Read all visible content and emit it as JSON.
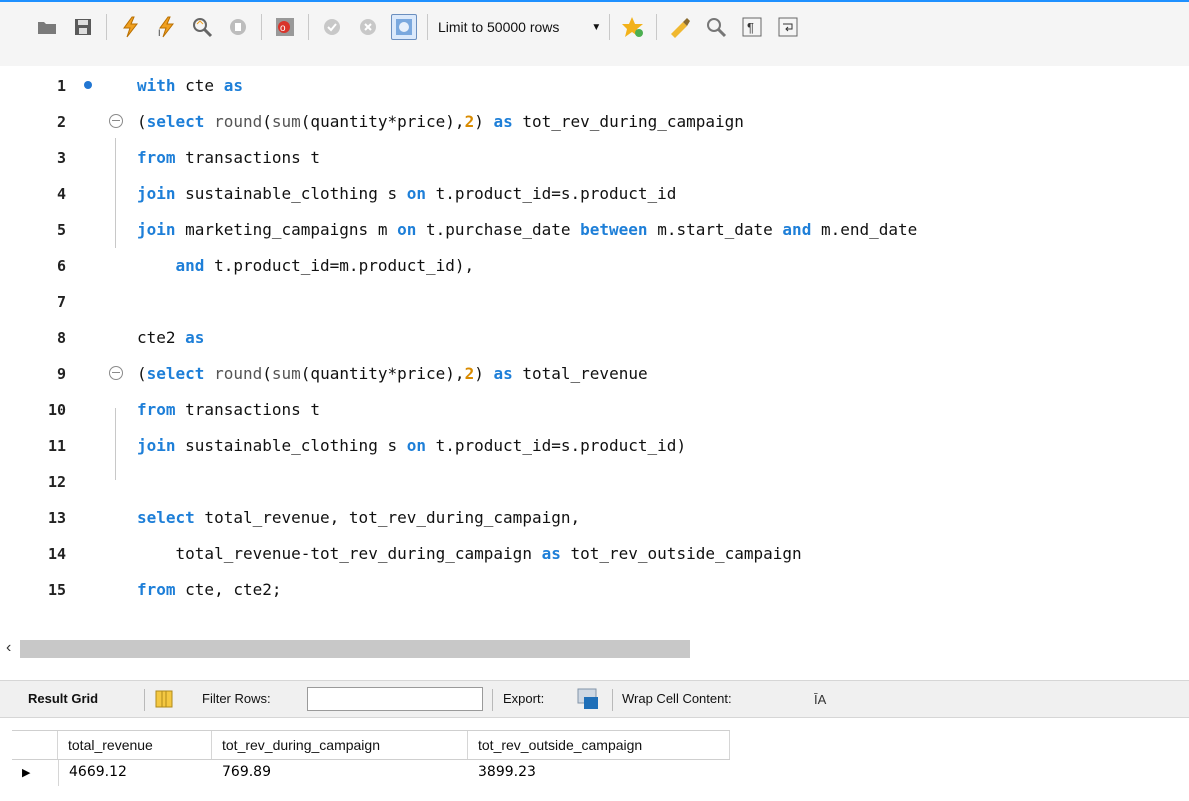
{
  "toolbar": {
    "limit_label": "Limit to 50000 rows",
    "buttons": [
      "open-folder-icon",
      "save-icon",
      "execute-icon",
      "execute-current-icon",
      "explain-icon",
      "stop-icon",
      "toggle-error-icon",
      "commit-icon",
      "rollback-icon",
      "autocommit-icon",
      "bookmark-icon",
      "beautify-icon",
      "find-icon",
      "invisible-chars-icon",
      "wrap-icon"
    ]
  },
  "editor": {
    "lines": [
      {
        "n": "1",
        "html": "<span class=\"kw\">with</span> cte <span class=\"kw\">as</span>"
      },
      {
        "n": "2",
        "html": "(<span class=\"kw\">select</span> <span class=\"fn\">round</span>(<span class=\"fn\">sum</span>(quantity*price),<span class=\"num\">2</span>) <span class=\"kw\">as</span> tot_rev_during_campaign"
      },
      {
        "n": "3",
        "html": "<span class=\"kw\">from</span> transactions t"
      },
      {
        "n": "4",
        "html": "<span class=\"kw\">join</span> sustainable_clothing s <span class=\"kw\">on</span> t.product_id=s.product_id"
      },
      {
        "n": "5",
        "html": "<span class=\"kw\">join</span> marketing_campaigns m <span class=\"kw\">on</span> t.purchase_date <span class=\"kw\">between</span> m.start_date <span class=\"kw\">and</span> m.end_date"
      },
      {
        "n": "6",
        "html": "    <span class=\"kw\">and</span> t.product_id=m.product_id),"
      },
      {
        "n": "7",
        "html": ""
      },
      {
        "n": "8",
        "html": "cte2 <span class=\"kw\">as</span>"
      },
      {
        "n": "9",
        "html": "(<span class=\"kw\">select</span> <span class=\"fn\">round</span>(<span class=\"fn\">sum</span>(quantity*price),<span class=\"num\">2</span>) <span class=\"kw\">as</span> total_revenue"
      },
      {
        "n": "10",
        "html": "<span class=\"kw\">from</span> transactions t"
      },
      {
        "n": "11",
        "html": "<span class=\"kw\">join</span> sustainable_clothing s <span class=\"kw\">on</span> t.product_id=s.product_id)"
      },
      {
        "n": "12",
        "html": ""
      },
      {
        "n": "13",
        "html": "<span class=\"kw\">select</span> total_revenue, tot_rev_during_campaign,"
      },
      {
        "n": "14",
        "html": "    total_revenue-tot_rev_during_campaign <span class=\"kw\">as</span> tot_rev_outside_campaign"
      },
      {
        "n": "15",
        "html": "<span class=\"kw\">from</span> cte, cte2;"
      }
    ]
  },
  "results": {
    "tab_label": "Result Grid",
    "filter_label": "Filter Rows:",
    "filter_value": "",
    "export_label": "Export:",
    "wrap_label": "Wrap Cell Content:",
    "columns": [
      "total_revenue",
      "tot_rev_during_campaign",
      "tot_rev_outside_campaign"
    ],
    "rows": [
      [
        "4669.12",
        "769.89",
        "3899.23"
      ]
    ]
  }
}
